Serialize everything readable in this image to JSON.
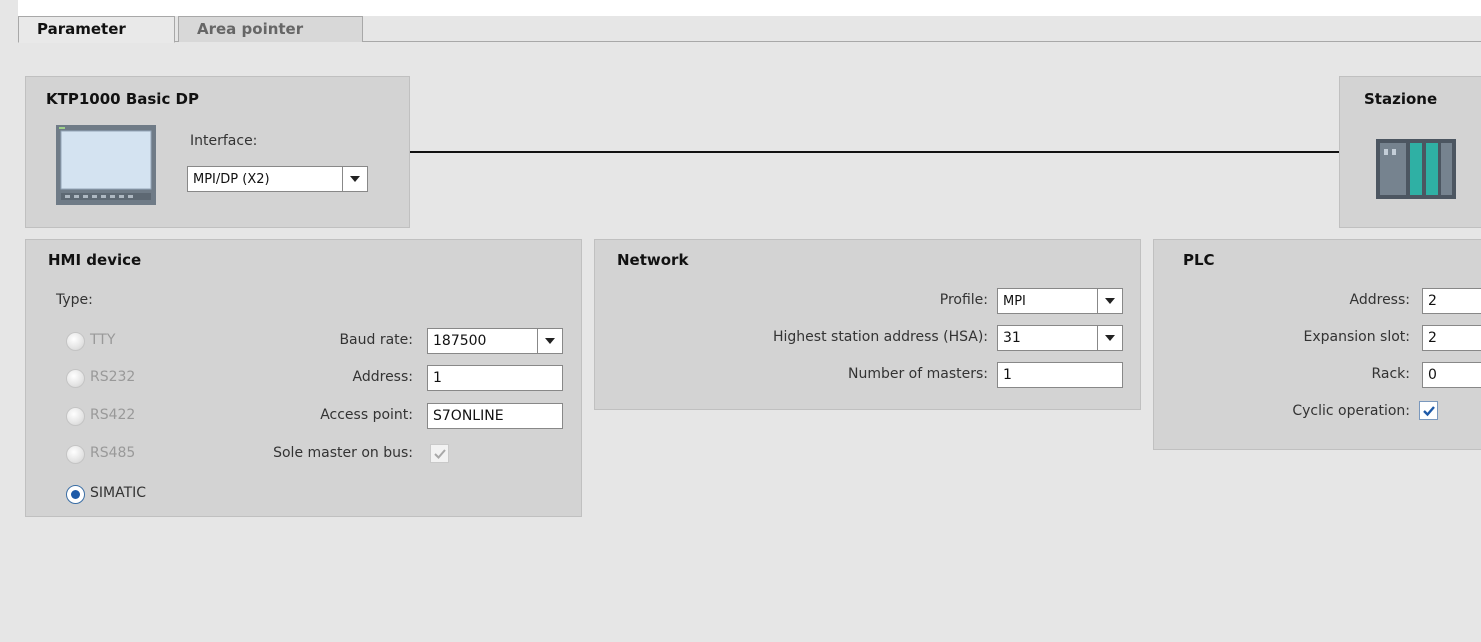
{
  "tabs": [
    {
      "label": "Parameter",
      "active": true
    },
    {
      "label": "Area pointer",
      "active": false
    }
  ],
  "device": {
    "title": "KTP1000 Basic DP",
    "interface_label": "Interface:",
    "interface_value": "MPI/DP (X2)",
    "icon": "hmi-panel-icon"
  },
  "station": {
    "title": "Stazione",
    "icon": "plc-station-icon"
  },
  "hmi": {
    "title": "HMI device",
    "type_label": "Type:",
    "types": [
      {
        "label": "TTY",
        "selected": false,
        "enabled": false
      },
      {
        "label": "RS232",
        "selected": false,
        "enabled": false
      },
      {
        "label": "RS422",
        "selected": false,
        "enabled": false
      },
      {
        "label": "RS485",
        "selected": false,
        "enabled": false
      },
      {
        "label": "SIMATIC",
        "selected": true,
        "enabled": true
      }
    ],
    "baud_rate_label": "Baud rate:",
    "baud_rate_value": "187500",
    "address_label": "Address:",
    "address_value": "1",
    "access_point_label": "Access point:",
    "access_point_value": "S7ONLINE",
    "sole_master_label": "Sole master on bus:",
    "sole_master_checked": true
  },
  "network": {
    "title": "Network",
    "profile_label": "Profile:",
    "profile_value": "MPI",
    "hsa_label": "Highest station address (HSA):",
    "hsa_value": "31",
    "masters_label": "Number of masters:",
    "masters_value": "1"
  },
  "plc": {
    "title": "PLC",
    "address_label": "Address:",
    "address_value": "2",
    "slot_label": "Expansion slot:",
    "slot_value": "2",
    "rack_label": "Rack:",
    "rack_value": "0",
    "cyclic_label": "Cyclic operation:",
    "cyclic_checked": true
  }
}
